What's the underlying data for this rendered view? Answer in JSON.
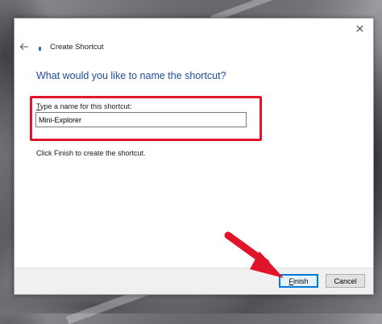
{
  "window": {
    "title": "Create Shortcut",
    "close_icon": "close-icon",
    "back_icon": "back-arrow-icon"
  },
  "main": {
    "heading": "What would you like to name the shortcut?",
    "field_label_first": "T",
    "field_label_rest": "ype a name for this shortcut:",
    "input_value": "Mini-Explorer",
    "hint": "Click Finish to create the shortcut."
  },
  "footer": {
    "finish_first": "F",
    "finish_rest": "inish",
    "cancel_label": "Cancel"
  },
  "annotation": {
    "highlight_color": "#e0142b",
    "arrow_color": "#e0142b"
  },
  "colors": {
    "heading": "#1f4b99",
    "accent": "#0078d7"
  }
}
